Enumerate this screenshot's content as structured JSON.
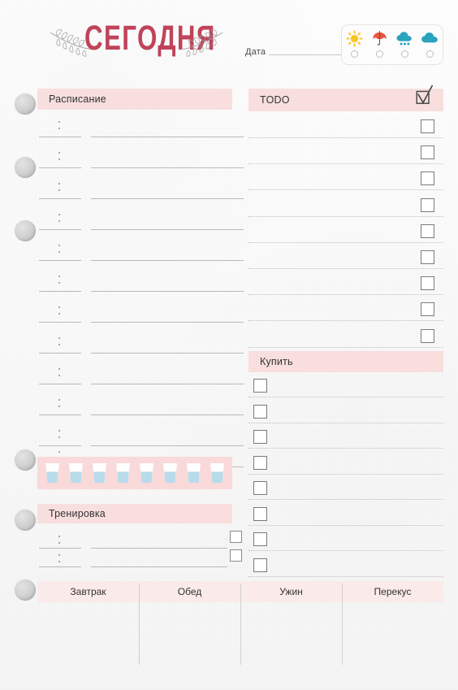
{
  "header": {
    "title": "СЕГОДНЯ",
    "date_label": "Дата",
    "date_value": "",
    "laurel_left_icon": "laurel-branch-left-icon",
    "laurel_right_icon": "laurel-branch-right-icon"
  },
  "weather": {
    "options": [
      {
        "name": "sunny",
        "icon": "sun-icon",
        "selected": false
      },
      {
        "name": "umbrella",
        "icon": "umbrella-icon",
        "selected": false
      },
      {
        "name": "rain",
        "icon": "rain-cloud-icon",
        "selected": false
      },
      {
        "name": "cloudy",
        "icon": "cloud-icon",
        "selected": false
      }
    ],
    "colors": {
      "sun": "#f8c524",
      "umbrella": "#e8573f",
      "cloud": "#2aa3bd"
    }
  },
  "schedule": {
    "band_label": "Расписание",
    "rows": [
      {
        "time": "",
        "note": ""
      },
      {
        "time": "",
        "note": ""
      },
      {
        "time": "",
        "note": ""
      },
      {
        "time": "",
        "note": ""
      },
      {
        "time": "",
        "note": ""
      },
      {
        "time": "",
        "note": ""
      },
      {
        "time": "",
        "note": ""
      },
      {
        "time": "",
        "note": ""
      },
      {
        "time": "",
        "note": ""
      },
      {
        "time": "",
        "note": ""
      },
      {
        "time": "",
        "note": ""
      },
      {
        "time": "",
        "note": ""
      }
    ]
  },
  "water": {
    "glass_count": 8,
    "glasses": [
      {
        "filled": true
      },
      {
        "filled": true
      },
      {
        "filled": true
      },
      {
        "filled": true
      },
      {
        "filled": true
      },
      {
        "filled": true
      },
      {
        "filled": true
      },
      {
        "filled": true
      }
    ],
    "water_color": "#b8dbea"
  },
  "workout": {
    "band_label": "Тренировка",
    "rows": [
      {
        "time": "",
        "note": "",
        "done": false
      },
      {
        "time": "",
        "note": "",
        "done": false
      }
    ]
  },
  "todo": {
    "band_label": "TODO",
    "header_icon": "checked-checkbox-icon",
    "items": [
      {
        "text": "",
        "done": false
      },
      {
        "text": "",
        "done": false
      },
      {
        "text": "",
        "done": false
      },
      {
        "text": "",
        "done": false
      },
      {
        "text": "",
        "done": false
      },
      {
        "text": "",
        "done": false
      },
      {
        "text": "",
        "done": false
      },
      {
        "text": "",
        "done": false
      },
      {
        "text": "",
        "done": false
      }
    ]
  },
  "shopping": {
    "band_label": "Купить",
    "items": [
      {
        "text": "",
        "done": false
      },
      {
        "text": "",
        "done": false
      },
      {
        "text": "",
        "done": false
      },
      {
        "text": "",
        "done": false
      },
      {
        "text": "",
        "done": false
      },
      {
        "text": "",
        "done": false
      },
      {
        "text": "",
        "done": false
      },
      {
        "text": "",
        "done": false
      }
    ]
  },
  "meals": {
    "columns": [
      {
        "label": "Завтрак",
        "value": ""
      },
      {
        "label": "Обед",
        "value": ""
      },
      {
        "label": "Ужин",
        "value": ""
      },
      {
        "label": "Перекус",
        "value": ""
      }
    ]
  },
  "theme": {
    "band_pink": "#f9dede",
    "band_pink_soft": "#fbeaea",
    "title_color": "#c0435a",
    "line_gray": "#b9b9b9",
    "hole_gray": "#cfcfcf"
  }
}
